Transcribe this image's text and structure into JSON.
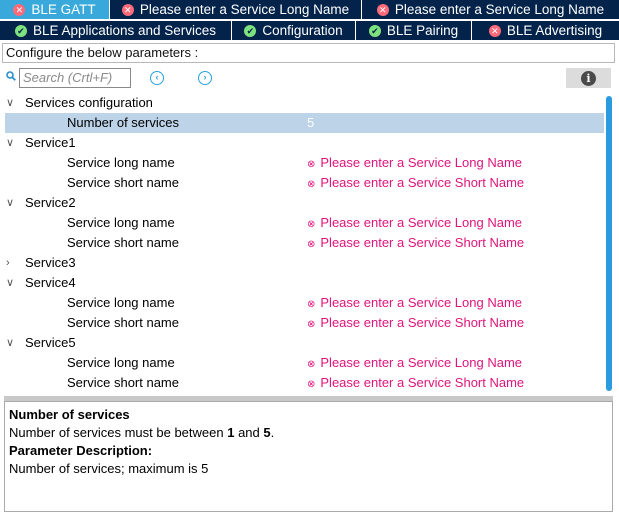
{
  "tabs_row1": [
    {
      "label": "BLE GATT",
      "status": "error",
      "active": true,
      "width": 110,
      "icon": "error-icon"
    },
    {
      "label": "Please enter a Service Long Name",
      "status": "error",
      "active": false,
      "width": 252,
      "icon": "error-icon"
    },
    {
      "label": "Please enter a Service Long Name",
      "status": "error",
      "active": false,
      "width": 257,
      "icon": "error-icon"
    }
  ],
  "tabs_row2": [
    {
      "label": "BLE Applications and Services",
      "status": "ok",
      "width": 232,
      "icon": "check-icon"
    },
    {
      "label": "Configuration",
      "status": "ok",
      "width": 124,
      "icon": "check-icon"
    },
    {
      "label": "BLE Pairing",
      "status": "ok",
      "width": 116,
      "icon": "check-icon"
    },
    {
      "label": "BLE Advertising",
      "status": "error",
      "width": 147,
      "icon": "error-icon"
    }
  ],
  "config_label": "Configure the below parameters :",
  "search": {
    "placeholder": "Search (Crtl+F)"
  },
  "tree": [
    {
      "type": "group",
      "label": "Services configuration",
      "expanded": true
    },
    {
      "type": "param",
      "label": "Number of services",
      "value": "5",
      "selected": true,
      "error": false
    },
    {
      "type": "group",
      "label": "Service1",
      "expanded": true
    },
    {
      "type": "param",
      "label": "Service long name",
      "value": "Please enter a Service Long Name",
      "error": true
    },
    {
      "type": "param",
      "label": "Service short name",
      "value": "Please enter a Service Short Name",
      "error": true
    },
    {
      "type": "group",
      "label": "Service2",
      "expanded": true
    },
    {
      "type": "param",
      "label": "Service long name",
      "value": "Please enter a Service Long Name",
      "error": true
    },
    {
      "type": "param",
      "label": "Service short name",
      "value": "Please enter a Service Short Name",
      "error": true
    },
    {
      "type": "group",
      "label": "Service3",
      "expanded": false
    },
    {
      "type": "group",
      "label": "Service4",
      "expanded": true
    },
    {
      "type": "param",
      "label": "Service long name",
      "value": "Please enter a Service Long Name",
      "error": true
    },
    {
      "type": "param",
      "label": "Service short name",
      "value": "Please enter a Service Short Name",
      "error": true
    },
    {
      "type": "group",
      "label": "Service5",
      "expanded": true
    },
    {
      "type": "param",
      "label": "Service long name",
      "value": "Please enter a Service Long Name",
      "error": true
    },
    {
      "type": "param",
      "label": "Service short name",
      "value": "Please enter a Service Short Name",
      "error": true
    }
  ],
  "description": {
    "title": "Number of services",
    "range_prefix": "Number of services must be between ",
    "range_min": "1",
    "range_mid": " and ",
    "range_max": "5",
    "range_suffix": ".",
    "param_header": "Parameter Description:",
    "param_text": "Number of services; maximum is 5"
  },
  "colors": {
    "tab_bg": "#03234b",
    "tab_active": "#39a9dc",
    "error_text": "#e0147c",
    "selected_row": "#bcd3e8",
    "scrollbar": "#2a9be0"
  }
}
